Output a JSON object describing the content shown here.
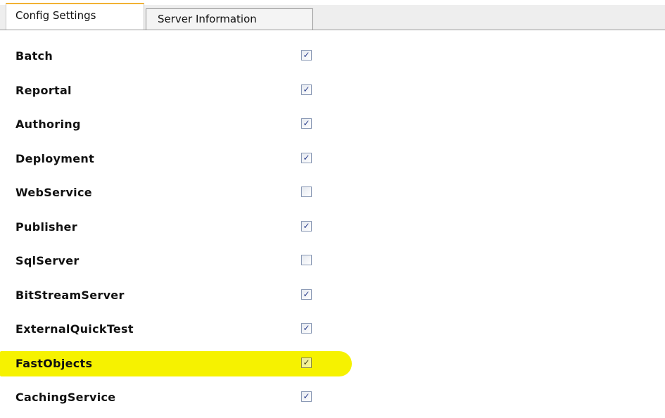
{
  "tabs": [
    {
      "label": "Config Settings",
      "active": true
    },
    {
      "label": "Server Information",
      "active": false
    }
  ],
  "highlight_color": "#f6f200",
  "checkmark_glyph": "✓",
  "settings": [
    {
      "label": "Batch",
      "checked": true
    },
    {
      "label": "Reportal",
      "checked": true
    },
    {
      "label": "Authoring",
      "checked": true
    },
    {
      "label": "Deployment",
      "checked": true
    },
    {
      "label": "WebService",
      "checked": false
    },
    {
      "label": "Publisher",
      "checked": true
    },
    {
      "label": "SqlServer",
      "checked": false
    },
    {
      "label": "BitStreamServer",
      "checked": true
    },
    {
      "label": "ExternalQuickTest",
      "checked": true
    },
    {
      "label": "FastObjects",
      "checked": true,
      "highlighted": true
    },
    {
      "label": "CachingService",
      "checked": true
    }
  ]
}
